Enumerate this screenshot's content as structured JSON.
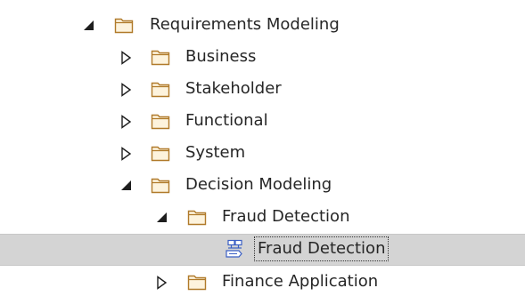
{
  "tree": {
    "items": [
      {
        "label": "Requirements Modeling",
        "state": "expanded",
        "icon": "folder-icon"
      },
      {
        "label": "Business",
        "state": "collapsed",
        "icon": "folder-icon"
      },
      {
        "label": "Stakeholder",
        "state": "collapsed",
        "icon": "folder-icon"
      },
      {
        "label": "Functional",
        "state": "collapsed",
        "icon": "folder-icon"
      },
      {
        "label": "System",
        "state": "collapsed",
        "icon": "folder-icon"
      },
      {
        "label": "Decision Modeling",
        "state": "expanded",
        "icon": "folder-icon"
      },
      {
        "label": "Fraud Detection",
        "state": "expanded",
        "icon": "folder-icon"
      },
      {
        "label": "Fraud Detection",
        "state": "leaf",
        "icon": "decision-diagram-icon",
        "selected": true
      },
      {
        "label": "Finance Application",
        "state": "collapsed",
        "icon": "folder-icon"
      }
    ]
  },
  "colors": {
    "folder_stroke": "#b07a2a",
    "folder_fill": "#fdf3dd",
    "diagram_stroke": "#3b5fc4",
    "selection_bg": "#d4d4d4",
    "text": "#262626"
  }
}
